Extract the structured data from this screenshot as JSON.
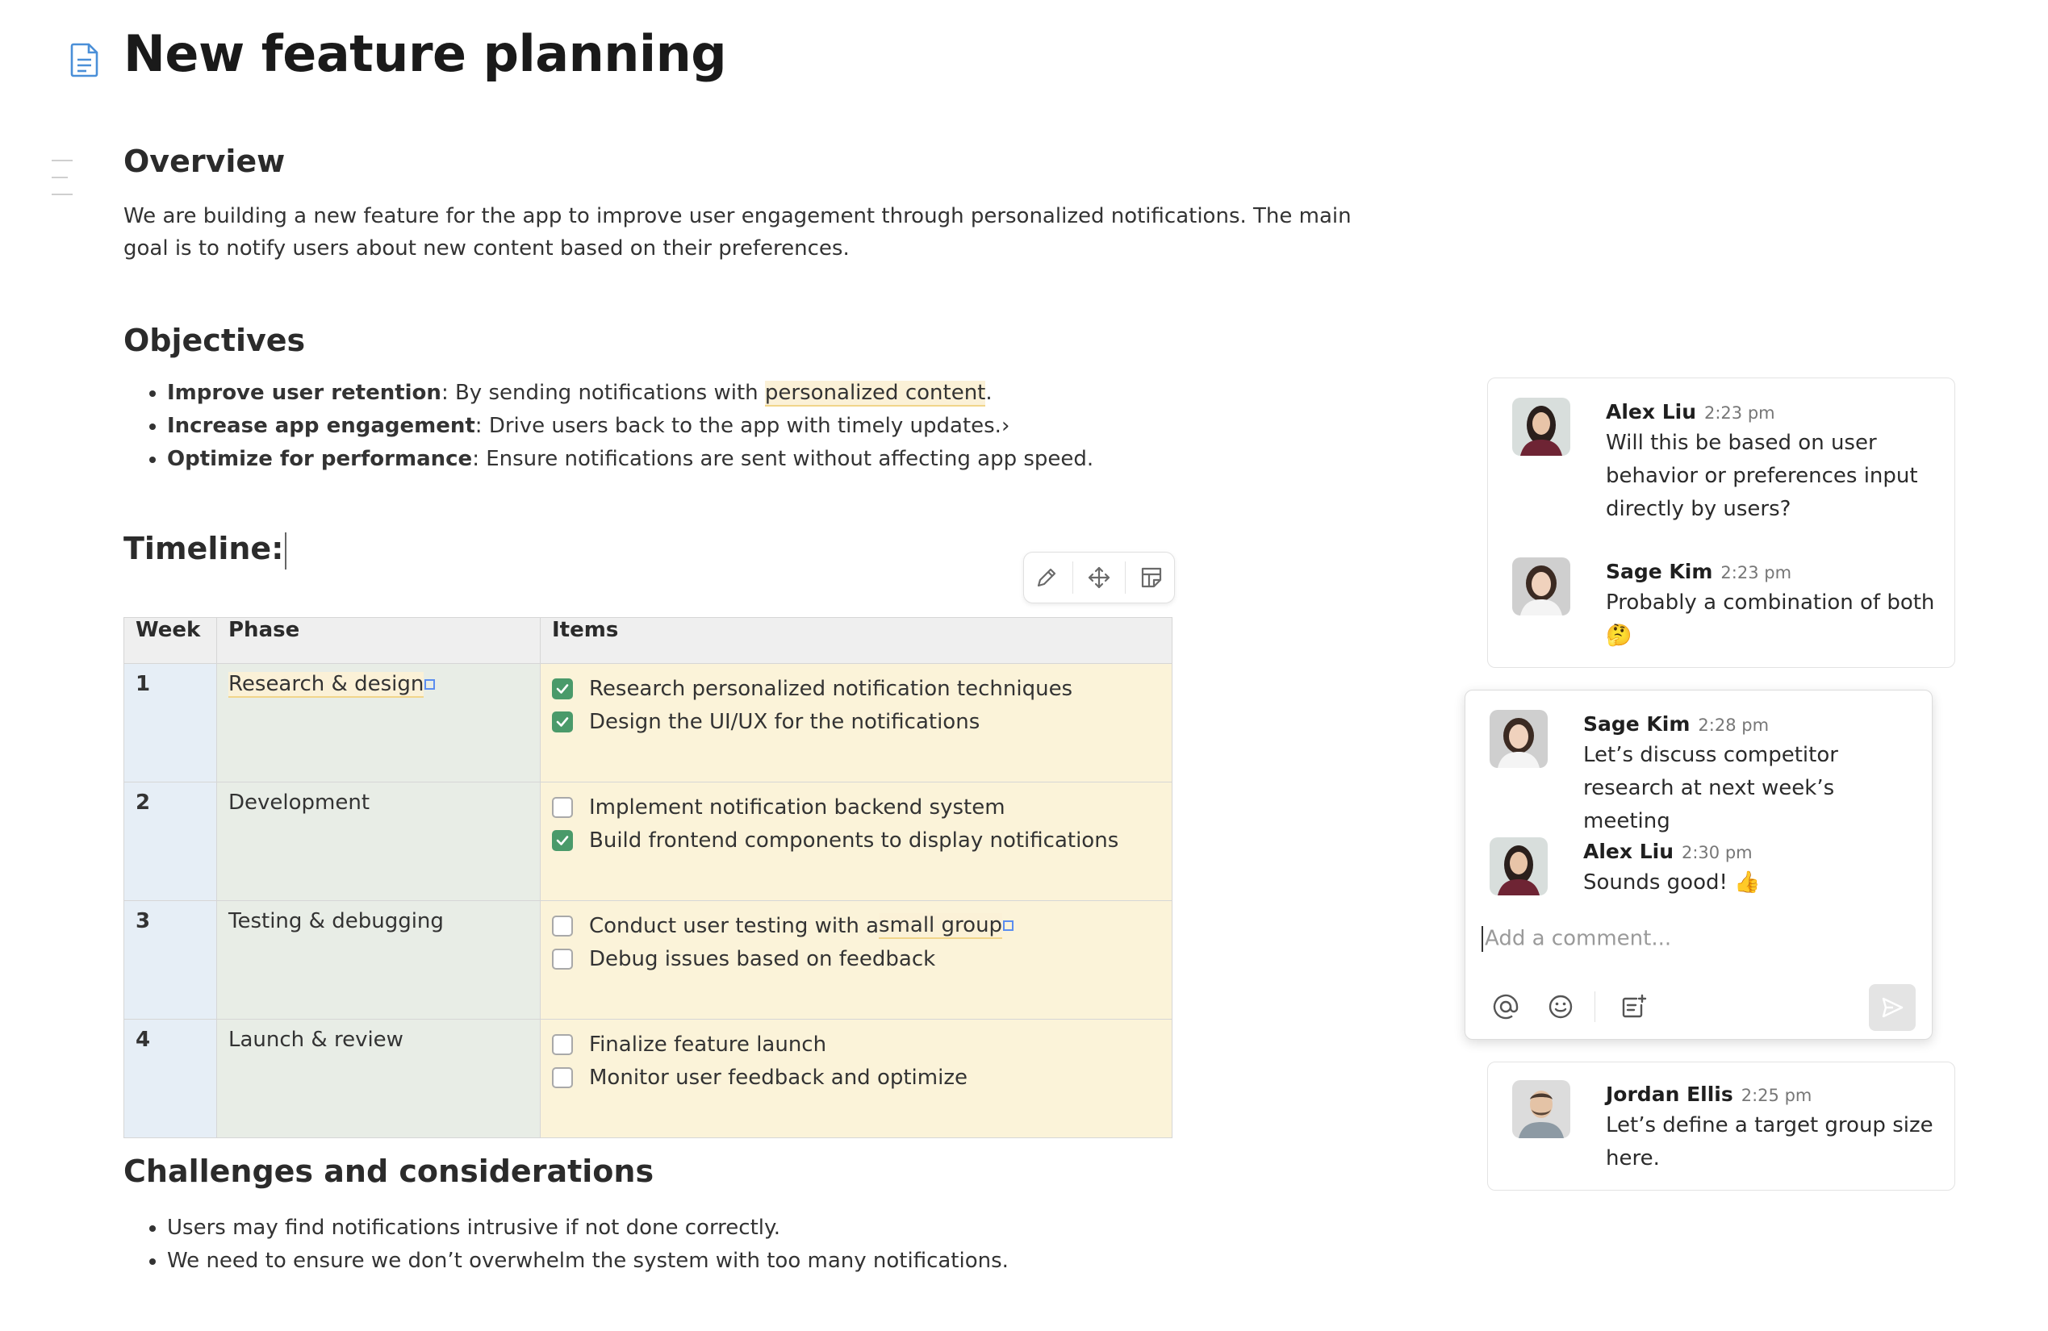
{
  "document": {
    "title": "New feature planning",
    "sections": {
      "overview": {
        "heading": "Overview",
        "text": "We are building a new feature for the app to improve user engagement through personalized notifications. The main goal is to notify users about new content based on their preferences."
      },
      "objectives": {
        "heading": "Objectives",
        "items": [
          {
            "bold": "Improve user retention",
            "text_before": ": By sending notifications with ",
            "highlight": "personalized content",
            "text_after": "."
          },
          {
            "bold": "Increase app engagement",
            "text": ": Drive users back to the app with timely updates.›"
          },
          {
            "bold": "Optimize for performance",
            "text": ": Ensure notifications are sent without affecting app speed."
          }
        ]
      },
      "timeline": {
        "heading": "Timeline:",
        "table": {
          "headers": [
            "Week",
            "Phase",
            "Items"
          ],
          "rows": [
            {
              "week": "1",
              "phase": "Research & design",
              "items": [
                {
                  "text": "Research personalized notification techniques",
                  "checked": true
                },
                {
                  "text": "Design the UI/UX for the notifications",
                  "checked": true
                }
              ]
            },
            {
              "week": "2",
              "phase": "Development",
              "items": [
                {
                  "text": "Implement notification backend system",
                  "checked": false
                },
                {
                  "text": "Build frontend components to display notifications",
                  "checked": true
                }
              ]
            },
            {
              "week": "3",
              "phase": "Testing & debugging",
              "items": [
                {
                  "text_before": "Conduct user testing with a ",
                  "highlight": "small group",
                  "checked": false
                },
                {
                  "text": "Debug issues based on feedback",
                  "checked": false
                }
              ]
            },
            {
              "week": "4",
              "phase": "Launch & review",
              "items": [
                {
                  "text": "Finalize feature launch",
                  "checked": false
                },
                {
                  "text": "Monitor user feedback and optimize",
                  "checked": false
                }
              ]
            }
          ]
        },
        "toolbar_icons": [
          "pencil-icon",
          "move-icon",
          "table-note-icon"
        ]
      },
      "challenges": {
        "heading": "Challenges and considerations",
        "items": [
          "Users may find notifications intrusive if not done correctly.",
          "We need to ensure we don’t overwhelm the system with too many notifications."
        ]
      }
    }
  },
  "comments": {
    "thread1": [
      {
        "author": "Alex Liu",
        "time": "2:23 pm",
        "text": "Will this be based on user behavior or preferences input directly by users?"
      },
      {
        "author": "Sage Kim",
        "time": "2:23 pm",
        "text": "Probably a combination of both 🤔"
      }
    ],
    "thread2": [
      {
        "author": "Sage Kim",
        "time": "2:28 pm",
        "text": "Let’s discuss competitor research at next week’s meeting"
      },
      {
        "author": "Alex Liu",
        "time": "2:30 pm",
        "text": "Sounds good! 👍"
      }
    ],
    "composer": {
      "placeholder": "Add a comment...",
      "tools": [
        "mention-icon",
        "emoji-icon",
        "attach-icon"
      ],
      "send_icon": "send-icon"
    },
    "thread3": [
      {
        "author": "Jordan Ellis",
        "time": "2:25 pm",
        "text": "Let’s define a target group size here."
      }
    ]
  },
  "colors": {
    "check_green": "#4a9a6a",
    "highlight": "#fbf1d7",
    "week_col": "#e6eef6",
    "phase_col": "#e8ede6",
    "items_col": "#fbf3d9"
  }
}
